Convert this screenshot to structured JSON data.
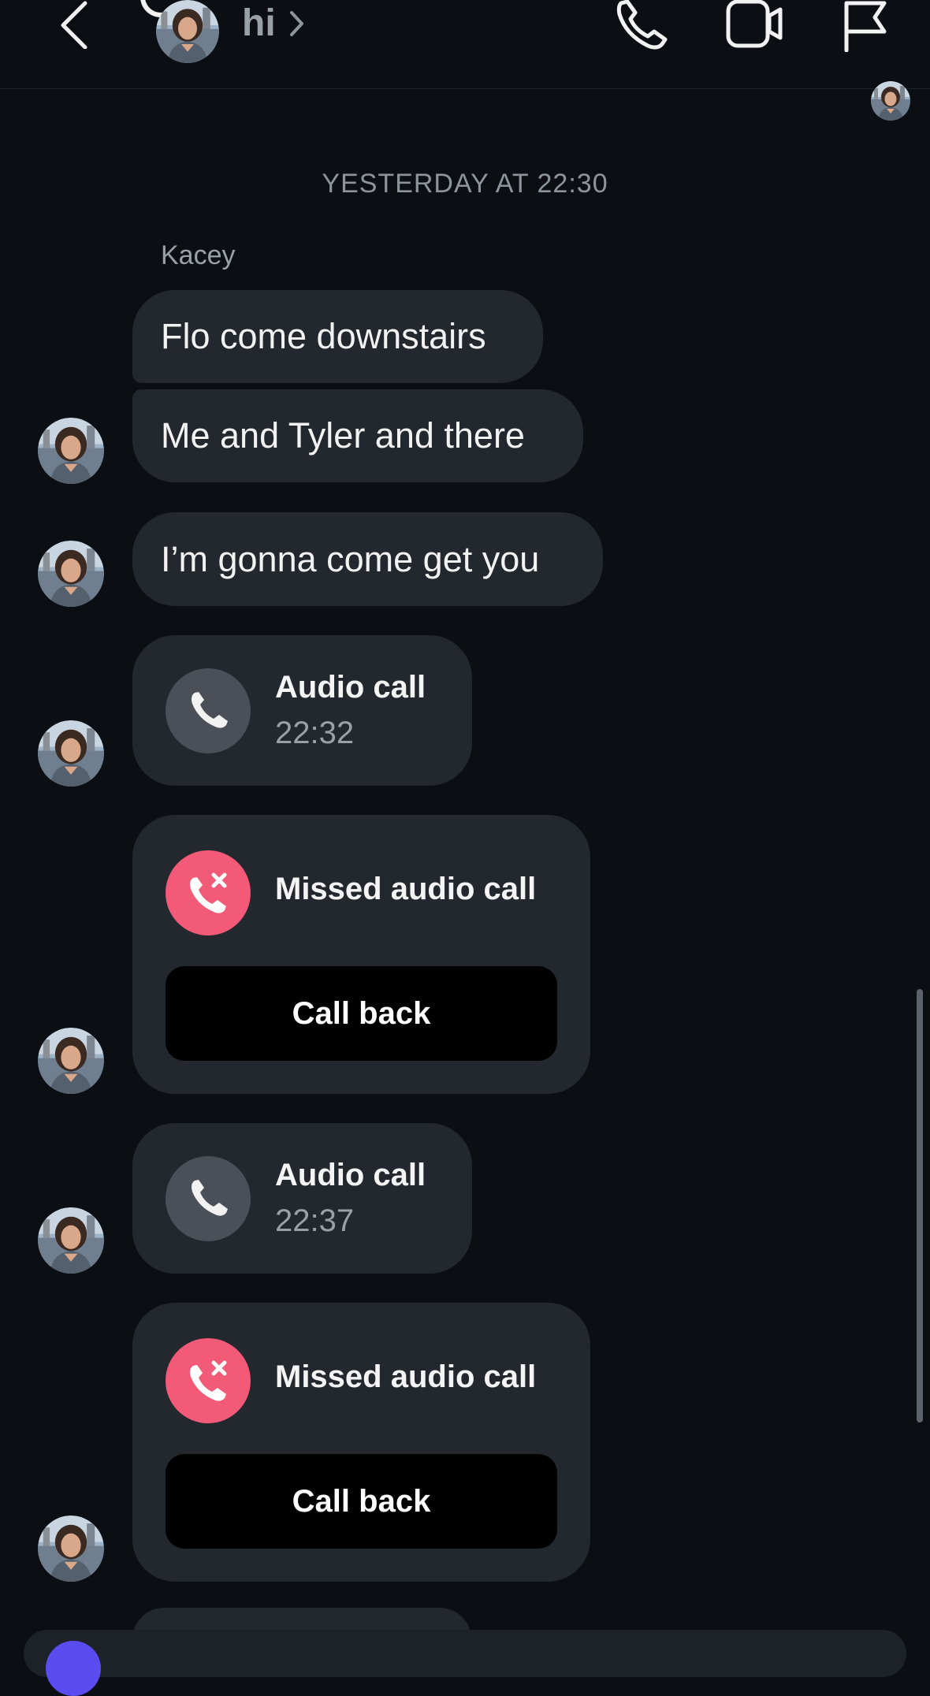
{
  "header": {
    "title": "hi",
    "back_icon": "chevron-left-icon",
    "title_chevron_icon": "chevron-right-icon",
    "actions": [
      "phone-icon",
      "video-icon",
      "flag-icon"
    ]
  },
  "conversation": {
    "timestamp": "YESTERDAY AT 22:30",
    "sender": "Kacey",
    "messages": [
      {
        "text": "Flo come downstairs"
      },
      {
        "text": "Me and Tyler and there"
      },
      {
        "text": "I’m gonna come get you"
      }
    ],
    "calls": [
      {
        "title": "Audio call",
        "time": "22:32",
        "missed": false
      },
      {
        "title": "Missed audio call",
        "action": "Call back",
        "missed": true
      },
      {
        "title": "Audio call",
        "time": "22:37",
        "missed": false
      },
      {
        "title": "Missed audio call",
        "action": "Call back",
        "missed": true
      }
    ]
  },
  "colors": {
    "background": "#0b0f14",
    "bubble": "#23272e",
    "missed_accent": "#f25a77",
    "call_icon_bg": "#4a4f58",
    "secondary_text": "#9aa0a8"
  }
}
